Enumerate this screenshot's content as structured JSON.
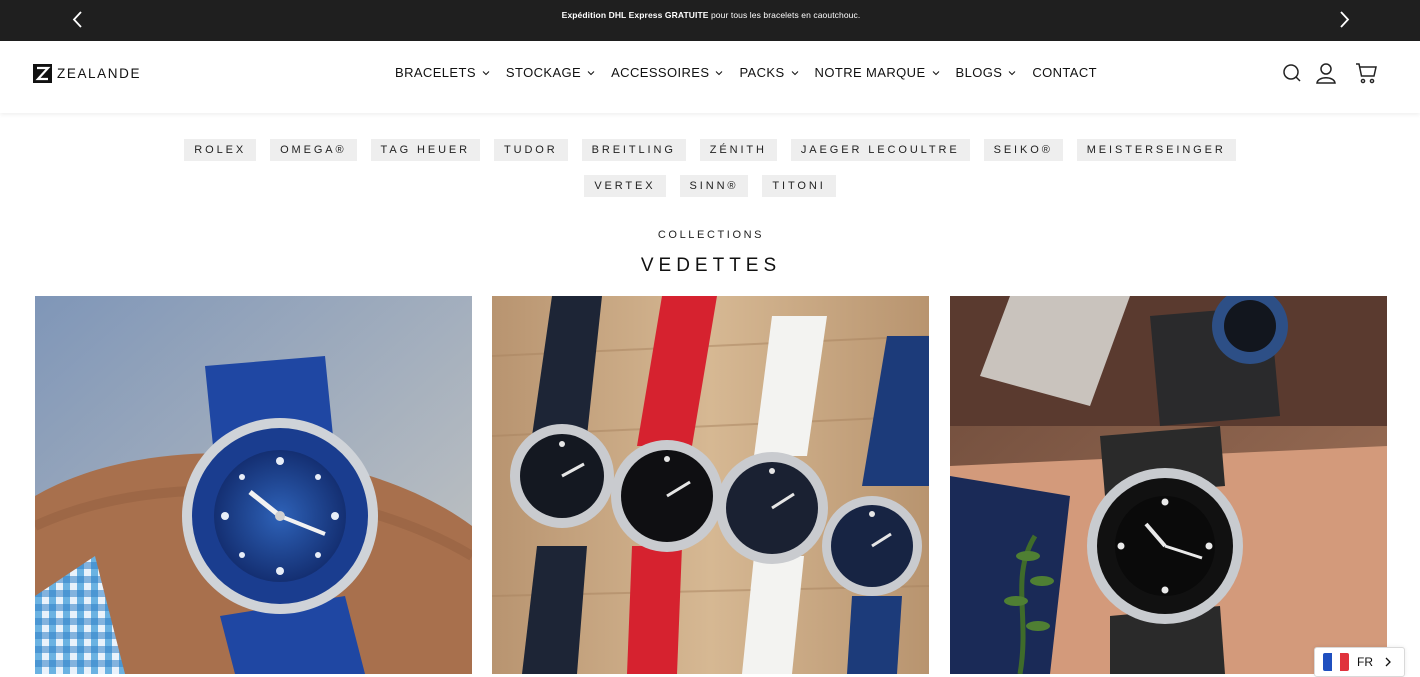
{
  "announcement": {
    "bold_text": "Expédition DHL Express GRATUITE",
    "rest_text": " pour tous les bracelets en caoutchouc."
  },
  "brand": {
    "name": "ZEALANDE"
  },
  "nav": {
    "items": [
      {
        "label": "BRACELETS",
        "has_dropdown": true
      },
      {
        "label": "STOCKAGE",
        "has_dropdown": true
      },
      {
        "label": "ACCESSOIRES",
        "has_dropdown": true
      },
      {
        "label": "PACKS",
        "has_dropdown": true
      },
      {
        "label": "NOTRE MARQUE",
        "has_dropdown": true
      },
      {
        "label": "BLOGS",
        "has_dropdown": true
      },
      {
        "label": "CONTACT",
        "has_dropdown": false
      }
    ]
  },
  "header_icons": [
    "search-icon",
    "account-icon",
    "cart-icon"
  ],
  "brand_chips": {
    "row1": [
      "ROLEX",
      "OMEGA®",
      "TAG HEUER",
      "TUDOR",
      "BREITLING",
      "ZÉNITH",
      "JAEGER LECOULTRE",
      "SEIKO®",
      "MEISTERSEINGER"
    ],
    "row2": [
      "VERTEX",
      "SINN®",
      "TITONI"
    ]
  },
  "section": {
    "eyebrow": "COLLECTIONS",
    "title": "VEDETTES"
  },
  "language": {
    "code": "FR"
  },
  "colors": {
    "announcement_bg": "#1f1f1f",
    "chip_bg": "#eeeeee",
    "text": "#111111"
  }
}
